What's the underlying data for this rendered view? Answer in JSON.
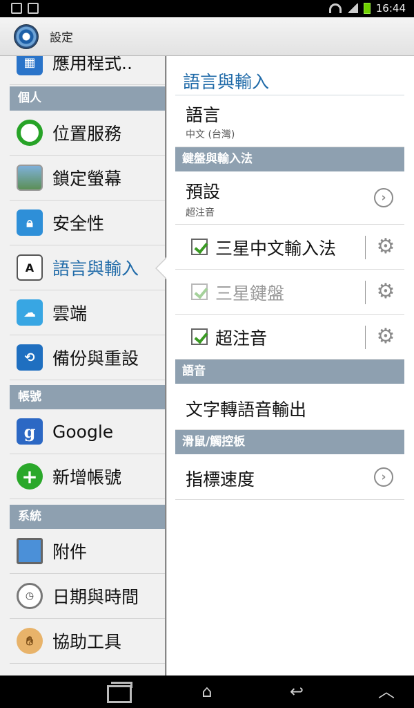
{
  "status_bar": {
    "time": "16:44"
  },
  "action_bar": {
    "title": "設定"
  },
  "left_list": {
    "items": [
      {
        "label": "應用程式..",
        "icon": "apps-icon"
      },
      {
        "header": "個人"
      },
      {
        "label": "位置服務",
        "icon": "location-icon"
      },
      {
        "label": "鎖定螢幕",
        "icon": "lock-screen-icon"
      },
      {
        "label": "安全性",
        "icon": "padlock-icon"
      },
      {
        "label": "語言與輸入",
        "icon": "language-icon",
        "active": true
      },
      {
        "label": "雲端",
        "icon": "cloud-icon"
      },
      {
        "label": "備份與重設",
        "icon": "backup-icon"
      },
      {
        "header": "帳號"
      },
      {
        "label": "Google",
        "icon": "google-icon"
      },
      {
        "label": "新增帳號",
        "icon": "add-account-icon"
      },
      {
        "header": "系統"
      },
      {
        "label": "附件",
        "icon": "accessory-icon"
      },
      {
        "label": "日期與時間",
        "icon": "clock-icon"
      },
      {
        "label": "協助工具",
        "icon": "hand-icon"
      }
    ]
  },
  "right_pane": {
    "title": "語言與輸入",
    "language": {
      "label": "語言",
      "value": "中文 (台灣)"
    },
    "keyboard_header": "鍵盤與輸入法",
    "default": {
      "label": "預設",
      "value": "超注音"
    },
    "input_methods": [
      {
        "label": "三星中文輸入法",
        "checked": true,
        "enabled": true
      },
      {
        "label": "三星鍵盤",
        "checked": true,
        "enabled": false
      },
      {
        "label": "超注音",
        "checked": true,
        "enabled": true
      }
    ],
    "speech_header": "語音",
    "tts": {
      "label": "文字轉語音輸出"
    },
    "mouse_header": "滑鼠/觸控板",
    "pointer_speed": {
      "label": "指標速度"
    }
  },
  "colors": {
    "accent": "#1f6aa8",
    "header": "#8ea0b0",
    "check": "#3a9a23"
  }
}
